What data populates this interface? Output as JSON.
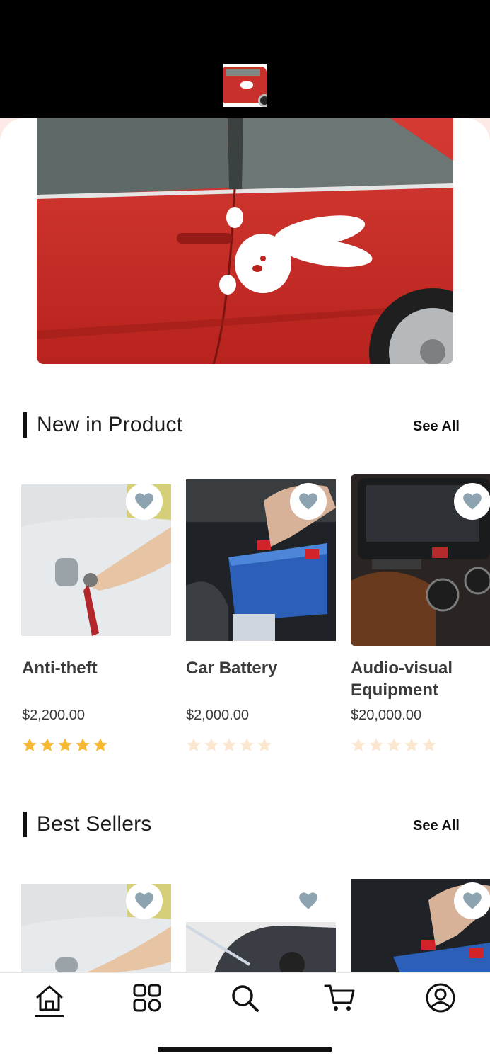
{
  "sections": {
    "new_in_product": {
      "title": "New in Product",
      "see_all": "See All"
    },
    "best_sellers": {
      "title": "Best Sellers",
      "see_all": "See All"
    }
  },
  "new_products": [
    {
      "name": "Anti-theft",
      "price": "$2,200.00",
      "rating": 5
    },
    {
      "name": "Car Battery",
      "price": "$2,000.00",
      "rating": 0
    },
    {
      "name": "Audio-visual Equipment",
      "price": "$20,000.00",
      "rating": 0
    }
  ],
  "tabs": [
    "home-icon",
    "categories-icon",
    "search-icon",
    "cart-icon",
    "profile-icon"
  ],
  "active_tab": "home-icon",
  "colors": {
    "star_filled": "#f5b82e",
    "star_empty": "#fbe6cf",
    "heart": "#8ea3b0",
    "hero_red": "#c52a24"
  }
}
